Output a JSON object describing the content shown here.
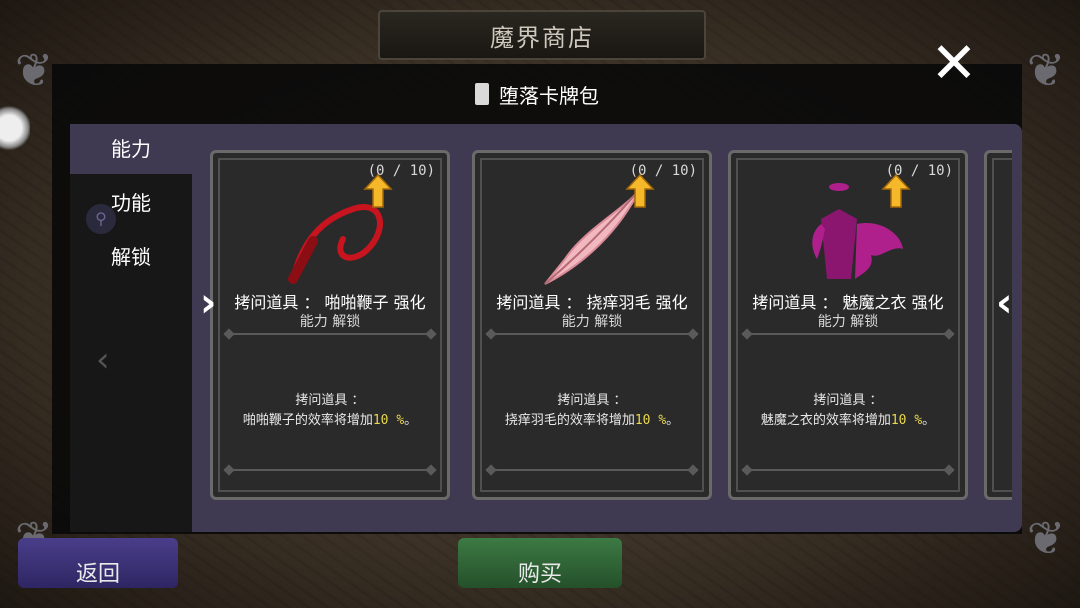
{
  "header": {
    "title": "魔界商店"
  },
  "pack": {
    "title": "堕落卡牌包"
  },
  "sidebar": {
    "items": [
      {
        "label": "能力",
        "active": true
      },
      {
        "label": "功能",
        "active": false
      },
      {
        "label": "解锁",
        "active": false
      }
    ]
  },
  "cards": [
    {
      "count": "(0 / 10)",
      "title": "拷问道具 ： 啪啪鞭子 强化",
      "subtitle": "能力 解锁",
      "desc_line1": "拷问道具 ：",
      "desc_prefix": "啪啪鞭子的效率将增加",
      "desc_value": "10 %",
      "desc_suffix": "。",
      "icon": "whip-icon",
      "color": "#c8141e"
    },
    {
      "count": "(0 / 10)",
      "title": "拷问道具 ： 挠痒羽毛 强化",
      "subtitle": "能力 解锁",
      "desc_line1": "拷问道具 ：",
      "desc_prefix": "挠痒羽毛的效率将增加",
      "desc_value": "10 %",
      "desc_suffix": "。",
      "icon": "feather-icon",
      "color": "#f2b8c0"
    },
    {
      "count": "(0 / 10)",
      "title": "拷问道具 ： 魅魔之衣 强化",
      "subtitle": "能力 解锁",
      "desc_line1": "拷问道具 ：",
      "desc_prefix": "魅魔之衣的效率将增加",
      "desc_value": "10 %",
      "desc_suffix": "。",
      "icon": "succubus-outfit-icon",
      "color": "#b0208c"
    }
  ],
  "footer": {
    "back_label": "返回",
    "buy_label": "购买"
  },
  "colors": {
    "accent_purple": "#3f3a52",
    "highlight": "#e8d84a",
    "upgrade_arrow": "#f5b82a"
  }
}
